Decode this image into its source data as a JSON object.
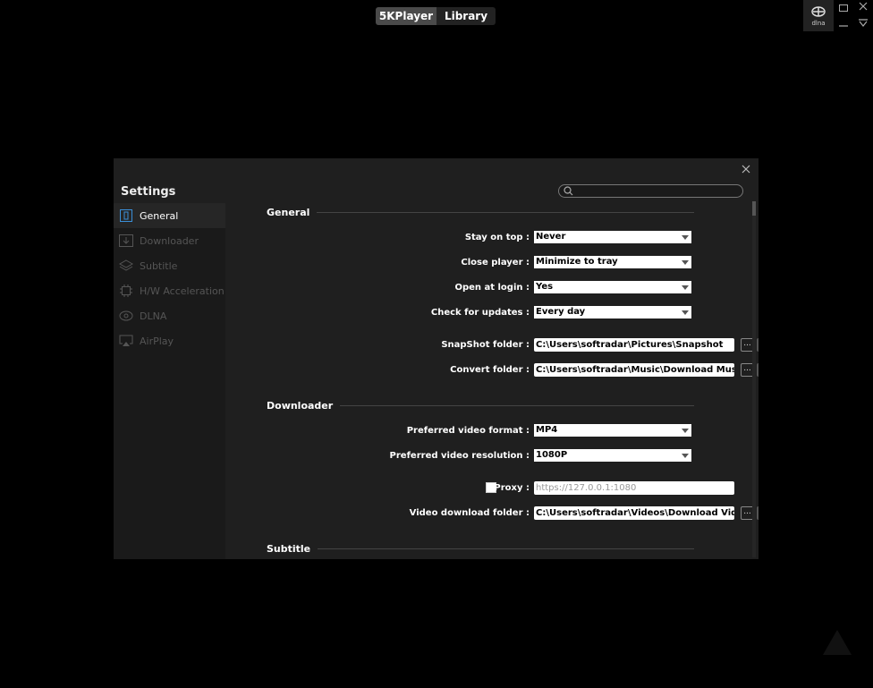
{
  "top_tabs": [
    {
      "label": "5KPlayer",
      "active": true
    },
    {
      "label": "Library",
      "active": false
    }
  ],
  "dlna_button": {
    "label": "dlna",
    "icon": "dlna-icon"
  },
  "window_controls": {
    "restore": "restore-icon",
    "minimize": "minimize-icon",
    "close": "close-icon",
    "menu": "menu-down-icon"
  },
  "settings": {
    "title": "Settings",
    "search": {
      "placeholder": "",
      "value": ""
    },
    "sidebar": [
      {
        "label": "General",
        "icon": "general-icon",
        "active": true
      },
      {
        "label": "Downloader",
        "icon": "downloader-icon",
        "active": false
      },
      {
        "label": "Subtitle",
        "icon": "subtitle-icon",
        "active": false
      },
      {
        "label": "H/W Acceleration",
        "icon": "chip-icon",
        "active": false
      },
      {
        "label": "DLNA",
        "icon": "dlna-icon",
        "active": false
      },
      {
        "label": "AirPlay",
        "icon": "airplay-icon",
        "active": false
      }
    ],
    "sections": {
      "general": "General",
      "downloader": "Downloader",
      "subtitle": "Subtitle"
    },
    "general": {
      "stay_on_top": {
        "label": "Stay on top :",
        "value": "Never"
      },
      "close_player": {
        "label": "Close player :",
        "value": "Minimize to tray"
      },
      "open_at_login": {
        "label": "Open at login :",
        "value": "Yes"
      },
      "check_updates": {
        "label": "Check for updates :",
        "value": "Every day"
      },
      "snapshot_folder": {
        "label": "SnapShot folder :",
        "value": "C:\\Users\\softradar\\Pictures\\Snapshot"
      },
      "convert_folder": {
        "label": "Convert folder :",
        "value": "C:\\Users\\softradar\\Music\\Download Music"
      }
    },
    "downloader": {
      "video_format": {
        "label": "Preferred video format :",
        "value": "MP4"
      },
      "video_resolution": {
        "label": "Preferred video resolution :",
        "value": "1080P"
      },
      "proxy": {
        "label": "Proxy :",
        "checked": false,
        "placeholder": "https://127.0.0.1:1080"
      },
      "download_folder": {
        "label": "Video download folder :",
        "value": "C:\\Users\\softradar\\Videos\\Download Videos"
      }
    },
    "browse_label": "..."
  },
  "colors": {
    "background": "#000000",
    "dialog": "#1f1f1f",
    "sidebar": "#1a1a1a",
    "active_item": "#262626",
    "accent_icon": "#3a8fd8"
  }
}
